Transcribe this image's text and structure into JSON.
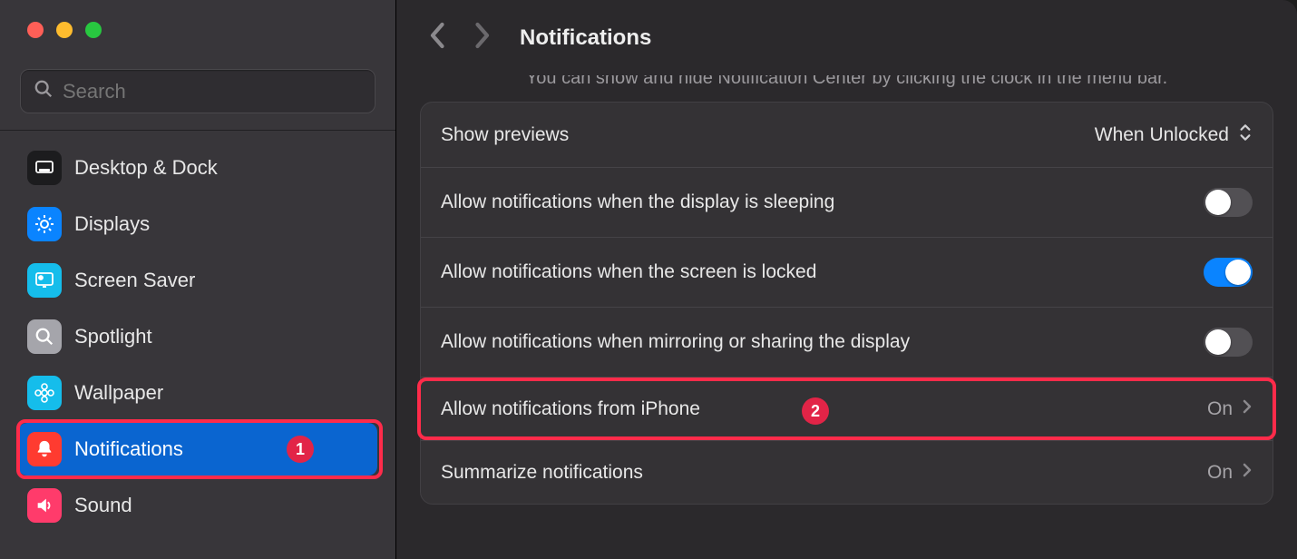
{
  "search": {
    "placeholder": "Search"
  },
  "sidebar": {
    "items": [
      {
        "label": "Desktop & Dock",
        "icon": "desktop",
        "bg": "#1c1c1e"
      },
      {
        "label": "Displays",
        "icon": "sun",
        "bg": "#0a84ff"
      },
      {
        "label": "Screen Saver",
        "icon": "screensaver",
        "bg": "#15bdeb"
      },
      {
        "label": "Spotlight",
        "icon": "search",
        "bg": "#a5a5ab"
      },
      {
        "label": "Wallpaper",
        "icon": "flower",
        "bg": "#15bdeb"
      },
      {
        "label": "Notifications",
        "icon": "bell",
        "bg": "#ff3b30",
        "selected": true,
        "annot": "1"
      },
      {
        "label": "Sound",
        "icon": "speaker",
        "bg": "#ff3b6b"
      }
    ]
  },
  "header": {
    "title": "Notifications"
  },
  "hint": "You can show and hide Notification Center by clicking the clock in the menu bar.",
  "settings": {
    "preview_label": "Show previews",
    "preview_value": "When Unlocked",
    "sleep_label": "Allow notifications when the display is sleeping",
    "locked_label": "Allow notifications when the screen is locked",
    "mirror_label": "Allow notifications when mirroring or sharing the display",
    "iphone_label": "Allow notifications from iPhone",
    "iphone_value": "On",
    "iphone_annot": "2",
    "summarize_label": "Summarize notifications",
    "summarize_value": "On"
  }
}
